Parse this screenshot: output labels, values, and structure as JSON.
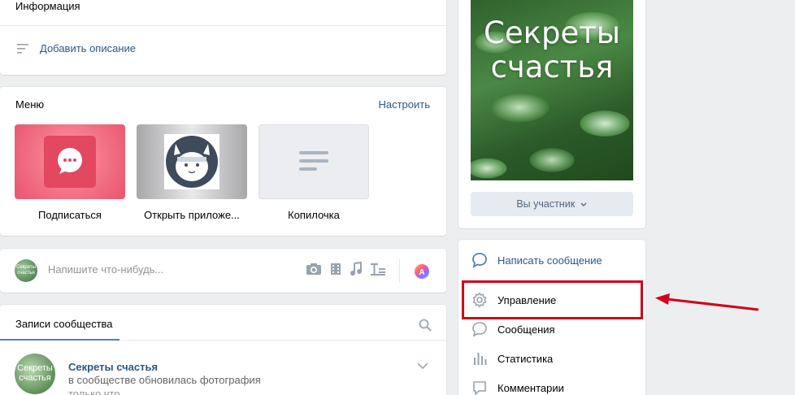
{
  "info": {
    "title": "Информация",
    "add_description": "Добавить описание"
  },
  "menu": {
    "title": "Меню",
    "configure": "Настроить",
    "tiles": [
      {
        "label": "Подписаться",
        "icon": "message-bubble-icon"
      },
      {
        "label": "Открыть приложе...",
        "icon": "cat-app-icon"
      },
      {
        "label": "Копилочка",
        "icon": "text-lines-icon"
      }
    ]
  },
  "composer": {
    "placeholder": "Напишите что-нибудь...",
    "avatar_text": "Секреты счастья",
    "tools": [
      "camera-icon",
      "video-icon",
      "music-icon",
      "text-format-icon",
      "palette-icon"
    ]
  },
  "posts": {
    "tab": "Записи сообщества",
    "post": {
      "avatar_text": "Секреты счастья",
      "author": "Секреты счастья",
      "text": "в сообществе обновилась фотография",
      "time": "только что"
    }
  },
  "cover": {
    "title": "Секреты счастья",
    "member_button": "Вы участник"
  },
  "actions": [
    {
      "label": "Написать сообщение",
      "icon": "chat-bubble-icon"
    },
    {
      "label": "Управление",
      "icon": "gear-icon"
    },
    {
      "label": "Сообщения",
      "icon": "message-icon"
    },
    {
      "label": "Статистика",
      "icon": "bar-chart-icon"
    },
    {
      "label": "Комментарии",
      "icon": "comment-icon"
    }
  ],
  "colors": {
    "link": "#2a5885",
    "accent": "#5181b8",
    "highlight": "#d0021b",
    "background": "#edeef0"
  }
}
